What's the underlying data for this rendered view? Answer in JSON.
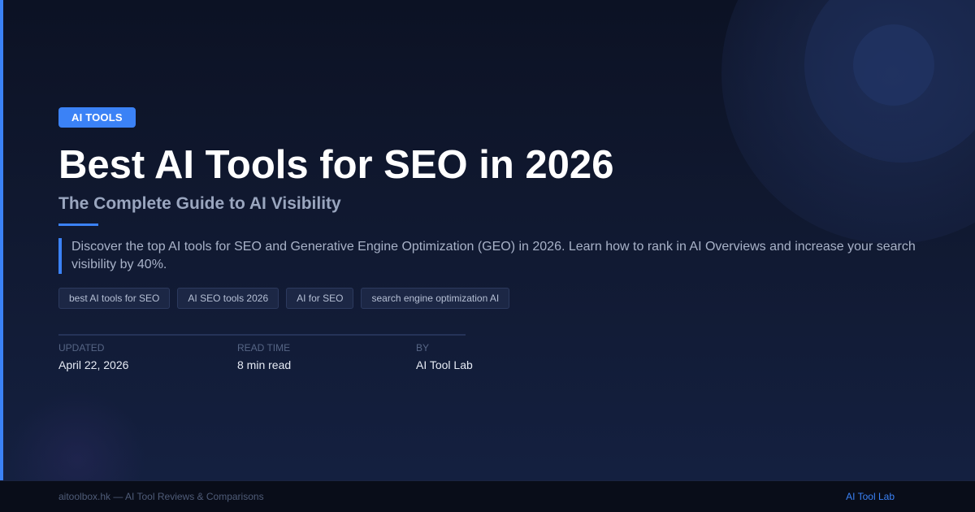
{
  "category_badge": "AI TOOLS",
  "title": "Best AI Tools for SEO in 2026",
  "subtitle": "The Complete Guide to AI Visibility",
  "description": "Discover the top AI tools for SEO and Generative Engine Optimization (GEO) in 2026. Learn how to rank in AI Overviews and increase your search visibility by 40%.",
  "tags": [
    "best AI tools for SEO",
    "AI SEO tools 2026",
    "AI for SEO",
    "search engine optimization AI"
  ],
  "meta": {
    "updated": {
      "label": "UPDATED",
      "value": "April 22, 2026"
    },
    "read_time": {
      "label": "READ TIME",
      "value": "8 min read"
    },
    "author": {
      "label": "BY",
      "value": "AI Tool Lab"
    }
  },
  "footer": {
    "left": "aitoolbox.hk — AI Tool Reviews & Comparisons",
    "right": "AI Tool Lab"
  },
  "colors": {
    "accent": "#3b82f6",
    "background": "#0d1326",
    "footer_background": "#090d19"
  }
}
